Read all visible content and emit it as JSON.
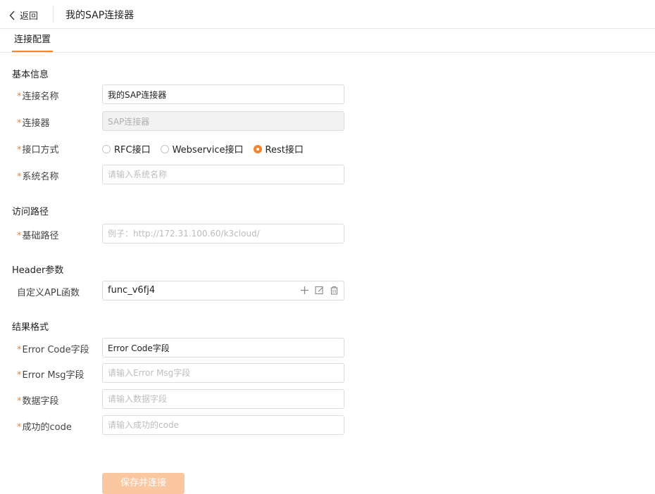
{
  "header": {
    "back_label": "返回",
    "title": "我的SAP连接器"
  },
  "tabs": [
    {
      "label": "连接配置"
    }
  ],
  "sections": {
    "basic": "基本信息",
    "path": "访问路径",
    "header_params": "Header参数",
    "result": "结果格式"
  },
  "required_mark": "*",
  "fields": {
    "connection_name": {
      "label": "连接名称",
      "value": "我的SAP连接器"
    },
    "connector": {
      "label": "连接器",
      "value": "SAP连接器"
    },
    "interface": {
      "label": "接口方式",
      "options": [
        "RFC接口",
        "Webservice接口",
        "Rest接口"
      ],
      "selected": "Rest接口"
    },
    "system_name": {
      "label": "系统名称",
      "placeholder": "请输入系统名称"
    },
    "base_path": {
      "label": "基础路径",
      "placeholder": "例子：http://172.31.100.60/k3cloud/"
    },
    "custom_apl": {
      "label": "自定义APL函数",
      "value": "func_v6fj4"
    },
    "error_code": {
      "label": "Error Code字段",
      "value": "Error Code字段"
    },
    "error_msg": {
      "label": "Error Msg字段",
      "placeholder": "请输入Error Msg字段"
    },
    "data_field": {
      "label": "数据字段",
      "placeholder": "请输入数据字段"
    },
    "success_code": {
      "label": "成功的code",
      "placeholder": "请输入成功的code"
    }
  },
  "icons": {
    "func_actions": [
      "plus-icon",
      "edit-icon",
      "trash-icon"
    ]
  },
  "colors": {
    "accent": "#f5832a",
    "button_disabled": "#fbc7a0"
  },
  "actions": {
    "save_label": "保存并连接"
  }
}
